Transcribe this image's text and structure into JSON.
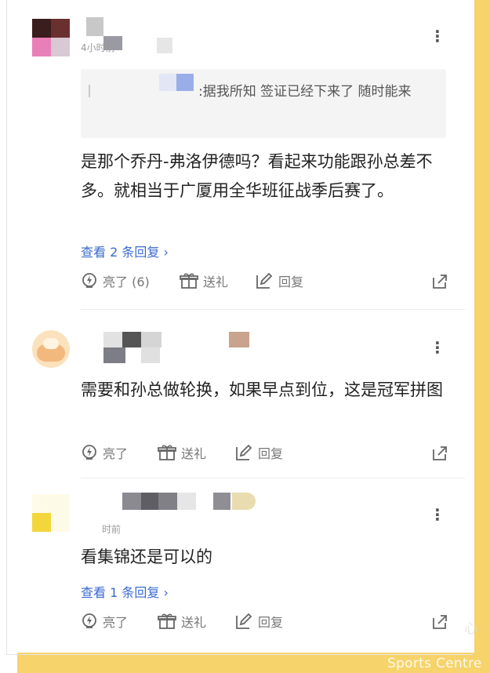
{
  "comments": [
    {
      "time": "4小时前",
      "quote": ":据我所知 签证已经下来了 随时能来",
      "body": "是那个乔丹-弗洛伊德吗？看起来功能跟孙总差不多。就相当于广厦用全华班征战季后赛了。",
      "replies": "查看 2 条回复 ›",
      "likes": "亮了 (6)",
      "gift": "送礼",
      "reply": "回复"
    },
    {
      "time": "",
      "body": "需要和孙总做轮换，如果早点到位，这是冠军拼图",
      "likes": "亮了",
      "gift": "送礼",
      "reply": "回复"
    },
    {
      "time": "时前",
      "body": "看集锦还是可以的",
      "replies": "查看 1 条回复 ›",
      "likes": "亮了",
      "gift": "送礼",
      "reply": "回复"
    }
  ],
  "watermark": "Sports Centre",
  "watermark_cn": "心",
  "colors": {
    "frame": "#f6d36b",
    "link": "#3a6ad1"
  }
}
